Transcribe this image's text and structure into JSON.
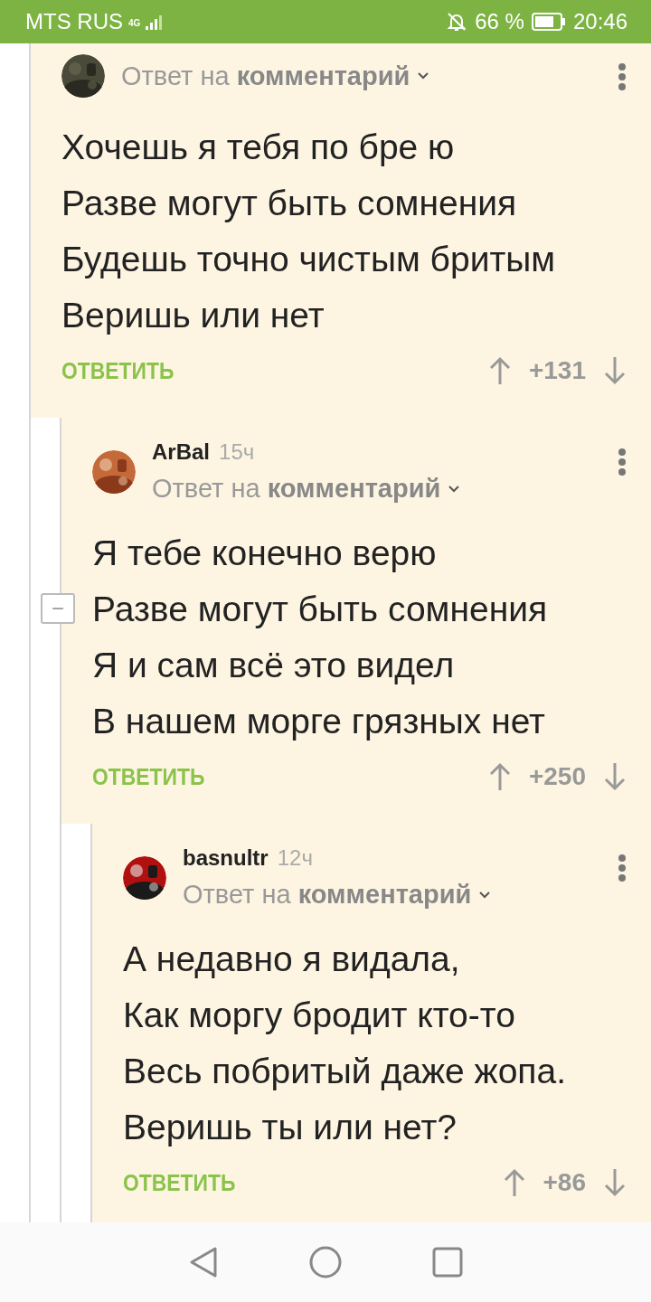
{
  "status_bar": {
    "carrier": "MTS RUS",
    "network": "4G",
    "battery": "66 %",
    "time": "20:46"
  },
  "comments": [
    {
      "reply_to": "Ответ на **комментарий**",
      "lines": [
        "Хочешь я тебя по бре ю",
        "Разве могут быть сомнения",
        "Будешь точно чистым бритым",
        "Веришь или нет"
      ],
      "reply_button": "ОТВЕТИТЬ",
      "score": "+131",
      "children": [
        {
          "author": "ArBal",
          "age": "15ч",
          "reply_to": "Ответ на **комментарий**",
          "lines": [
            "Я тебе конечно верю",
            "Разве могут быть сомнения",
            "Я и сам всё это видел",
            "В нашем морге грязных нет"
          ],
          "reply_button": "ОТВЕТИТЬ",
          "score": "+250",
          "collapse": "−",
          "children": [
            {
              "author": "basnultr",
              "age": "12ч",
              "reply_to": "Ответ на **комментарий**",
              "lines": [
                "А недавно я видала,",
                "Как моргу бродит кто-то",
                "Весь побритый даже жопа.",
                "Веришь ты или нет?"
              ],
              "reply_button": "ОТВЕТИТЬ",
              "score": "+86"
            }
          ]
        }
      ]
    }
  ]
}
